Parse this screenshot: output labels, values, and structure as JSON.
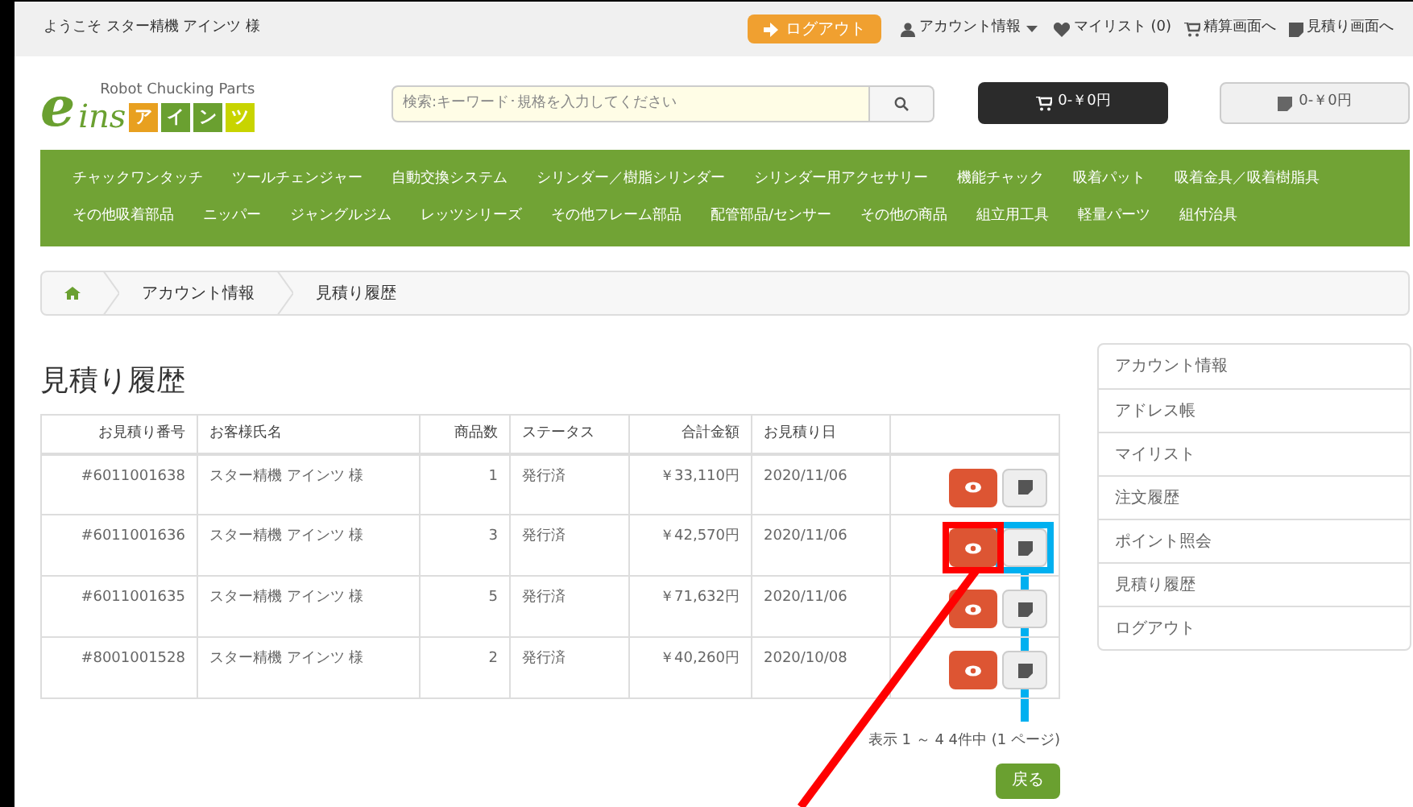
{
  "top_bar": {
    "welcome": "ようこそ スター精機 アインツ 様",
    "logout": "ログアウト",
    "links": [
      {
        "kind": "account",
        "label": "アカウント情報",
        "dropdown": true
      },
      {
        "kind": "mylist",
        "label": "マイリスト (0)"
      },
      {
        "kind": "checkout",
        "label": "精算画面へ"
      },
      {
        "kind": "quote",
        "label": "見積り画面へ"
      }
    ]
  },
  "header": {
    "logo_letter": "e",
    "logo_tagline": "Robot Chucking Parts",
    "logo_word": "ins",
    "logo_kana": [
      "ア",
      "イ",
      "ン",
      "ツ"
    ],
    "search": {
      "placeholder": "検索:キーワード･規格を入力してください"
    },
    "cart": "0-￥0円",
    "quote_cart": "0-￥0円"
  },
  "nav": [
    [
      "チャックワンタッチ",
      "ツールチェンジャー",
      "自動交換システム",
      "シリンダー／樹脂シリンダー",
      "シリンダー用アクセサリー",
      "機能チャック",
      "吸着パット",
      "吸着金具／吸着樹脂具"
    ],
    [
      "その他吸着部品",
      "ニッパー",
      "ジャングルジム",
      "レッツシリーズ",
      "その他フレーム部品",
      "配管部品/センサー",
      "その他の商品",
      "組立用工具",
      "軽量パーツ",
      "組付治具"
    ]
  ],
  "breadcrumb": [
    "アカウント情報",
    "見積り履歴"
  ],
  "title": "見積り履歴",
  "table": {
    "columns": [
      "お見積り番号",
      "お客様氏名",
      "商品数",
      "ステータス",
      "合計金額",
      "お見積り日"
    ],
    "rows": [
      {
        "cells": [
          "#6011001638",
          "スター精機 アインツ 様",
          "1",
          "発行済",
          "￥33,110円",
          "2020/11/06"
        ]
      },
      {
        "cells": [
          "#6011001636",
          "スター精機 アインツ 様",
          "3",
          "発行済",
          "￥42,570円",
          "2020/11/06"
        ]
      },
      {
        "cells": [
          "#6011001635",
          "スター精機 アインツ 様",
          "5",
          "発行済",
          "￥71,632円",
          "2020/11/06"
        ]
      },
      {
        "cells": [
          "#8001001528",
          "スター精機 アインツ 様",
          "2",
          "発行済",
          "￥40,260円",
          "2020/10/08"
        ]
      }
    ]
  },
  "pagination": "表示 1 ～ 4 4件中 (1 ページ)",
  "back_button": "戻る",
  "sidebar": {
    "items": [
      "アカウント情報",
      "アドレス帳",
      "マイリスト",
      "注文履歴",
      "ポイント照会",
      "見積り履歴",
      "ログアウト"
    ]
  },
  "annotations": [
    {
      "kind": "view",
      "color": "#ff0000"
    },
    {
      "kind": "edit",
      "color": "#00b0f0"
    }
  ]
}
